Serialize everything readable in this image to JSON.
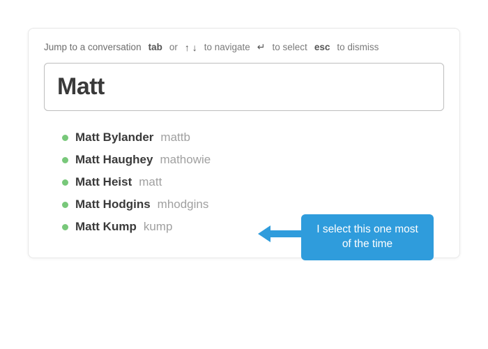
{
  "hints": {
    "lead": "Jump to a conversation",
    "tab": "tab",
    "or": "or",
    "arrows": "↑ ↓",
    "navigate": "to navigate",
    "enter": "↵",
    "select": "to select",
    "esc": "esc",
    "dismiss": "to dismiss"
  },
  "search": {
    "value": "Matt"
  },
  "results": [
    {
      "name": "Matt Bylander",
      "handle": "mattb"
    },
    {
      "name": "Matt Haughey",
      "handle": "mathowie"
    },
    {
      "name": "Matt Heist",
      "handle": "matt"
    },
    {
      "name": "Matt Hodgins",
      "handle": "mhodgins"
    },
    {
      "name": "Matt Kump",
      "handle": "kump"
    }
  ],
  "callout": {
    "text": "I select this one most of the time"
  },
  "colors": {
    "presence": "#78c87a",
    "callout": "#2f9cdc"
  }
}
